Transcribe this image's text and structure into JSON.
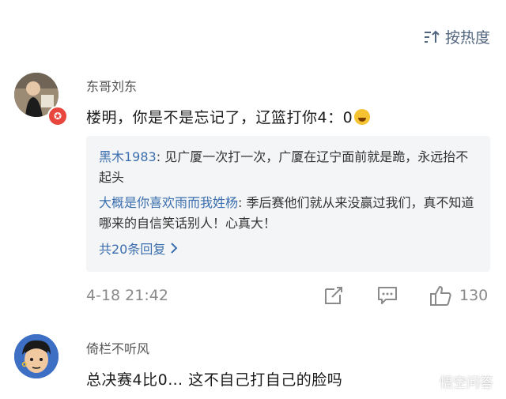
{
  "sort": {
    "label": "按热度"
  },
  "comments": [
    {
      "username": "东哥刘东",
      "text": "楼明，你是不是忘记了，辽篮打你4：0",
      "replies": [
        {
          "name": "黑木1983",
          "text": ": 见广厦一次打一次，广厦在辽宁面前就是跪，永远抬不起头"
        },
        {
          "name": "大概是你喜欢雨而我姓杨",
          "text": ": 季后赛他们就从来没赢过我们，真不知道哪来的自信笑话别人！心真大！"
        }
      ],
      "replies_more": "共20条回复",
      "time": "4-18 21:42",
      "likes": "130"
    },
    {
      "username": "倚栏不听风",
      "text": "总决赛4比0… 这不自己打自己的脸吗"
    }
  ],
  "watermark": "悟空问答",
  "colors": {
    "link": "#3a6eae",
    "meta": "#8a8a8a",
    "reply_bg": "#f4f5f7",
    "badge": "#e8453c"
  }
}
